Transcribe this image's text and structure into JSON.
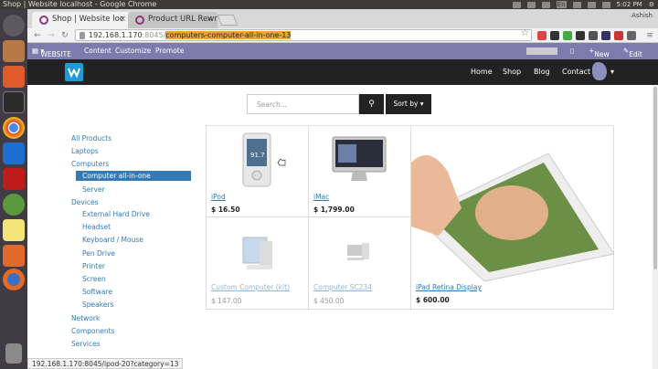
{
  "os": {
    "title": "Shop | Website localhost - Google Chrome",
    "time": "5:02 PM",
    "lang": "En",
    "user": "Ashish"
  },
  "browser": {
    "tabs": [
      {
        "label": "Shop | Website loc"
      },
      {
        "label": "Product URL Rewr"
      }
    ],
    "url_prefix": "192.168.1.170",
    "url_port": ":8045/",
    "url_selected": "computers-computer-all-in-one-13"
  },
  "admin": {
    "website": "WEBSITE",
    "content": "Content",
    "customize": "Customize",
    "promote": "Promote",
    "new": "New",
    "edit": "Edit"
  },
  "nav": {
    "home": "Home",
    "shop": "Shop",
    "blog": "Blog",
    "contact": "Contact us"
  },
  "search": {
    "placeholder": "Search...",
    "sort": "Sort by"
  },
  "categories": [
    "All Products",
    "Laptops",
    "Computers",
    "Computer all-in-one",
    "Server",
    "Devices",
    "External Hard Drive",
    "Headset",
    "Keyboard / Mouse",
    "Pen Drive",
    "Printer",
    "Screen",
    "Software",
    "Speakers",
    "Network",
    "Components",
    "Services"
  ],
  "products": [
    {
      "name": "iPod",
      "price": "$ 16.50"
    },
    {
      "name": "iMac",
      "price": "$ 1,799.00"
    },
    {
      "name": "iPad Retina Display",
      "price": "$ 600.00"
    },
    {
      "name": "Custom Computer (kit)",
      "price": "$ 147.00"
    },
    {
      "name": "Computer SC234",
      "price": "$ 450.00"
    }
  ],
  "status_url": "192.168.1.170:8045/ipod-20?category=13",
  "ipod_screen": "91.7"
}
